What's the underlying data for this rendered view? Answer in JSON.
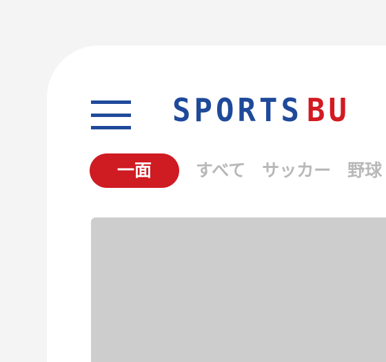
{
  "header": {
    "logo_part1": "SPORTS",
    "logo_part2": "BU",
    "menu_icon": "hamburger-menu-icon"
  },
  "tabs": [
    {
      "label": "一面",
      "active": true
    },
    {
      "label": "すべて",
      "active": false
    },
    {
      "label": "サッカー",
      "active": false
    },
    {
      "label": "野球",
      "active": false
    }
  ],
  "colors": {
    "brand_blue": "#1f4a9a",
    "brand_red": "#cf1b22",
    "tab_inactive": "#b8b8b8",
    "placeholder_gray": "#cdcdcd"
  }
}
